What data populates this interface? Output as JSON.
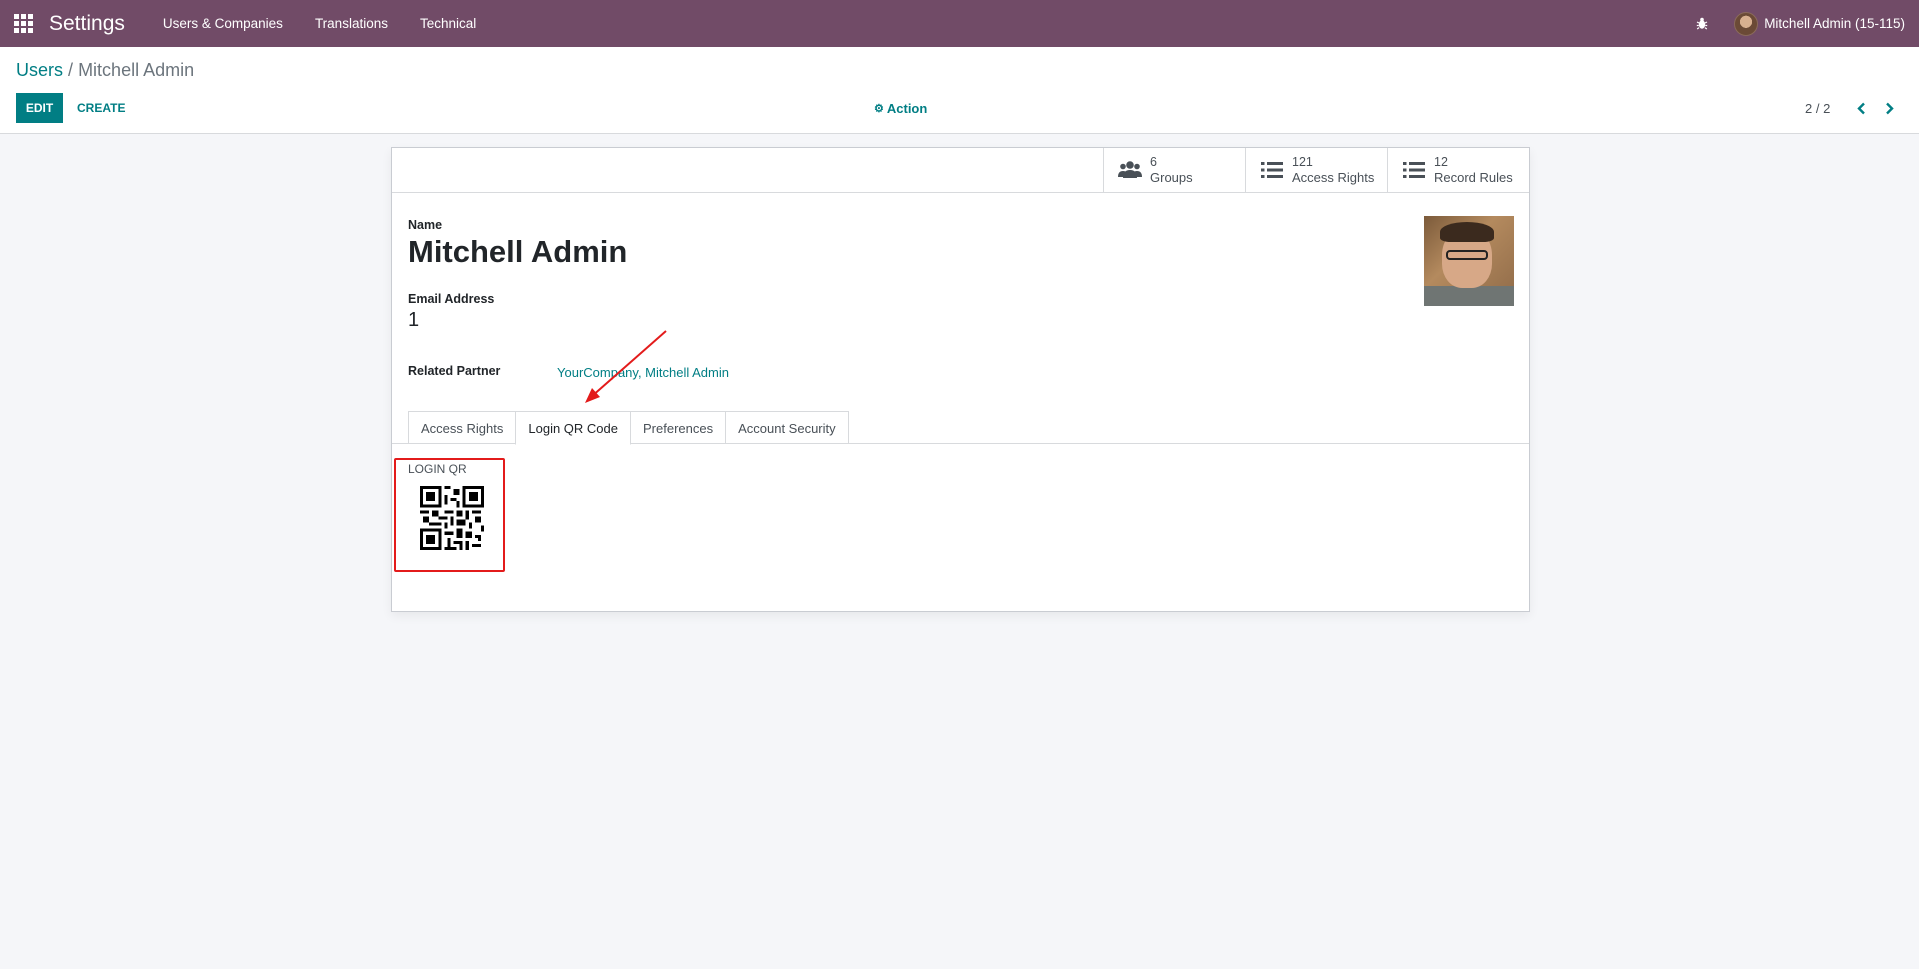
{
  "navbar": {
    "app_name": "Settings",
    "menu": [
      "Users & Companies",
      "Translations",
      "Technical"
    ],
    "user_name": "Mitchell Admin (15-115)",
    "bg_color": "#714b67",
    "icons": [
      "apps-grid-icon",
      "bug-icon"
    ]
  },
  "control_panel": {
    "breadcrumb_parent": "Users",
    "breadcrumb_separator": "/",
    "breadcrumb_current": "Mitchell Admin",
    "edit_label": "EDIT",
    "create_label": "CREATE",
    "action_label": "Action",
    "pager": "2 / 2",
    "accent_color": "#017e84"
  },
  "stat_buttons": [
    {
      "value": "6",
      "label": "Groups",
      "icon": "users-icon"
    },
    {
      "value": "121",
      "label": "Access Rights",
      "icon": "list-icon"
    },
    {
      "value": "12",
      "label": "Record Rules",
      "icon": "list-icon"
    }
  ],
  "form": {
    "name_label": "Name",
    "name_value": "Mitchell Admin",
    "email_label": "Email Address",
    "email_value": "1",
    "partner_label": "Related Partner",
    "partner_value": "YourCompany, Mitchell Admin"
  },
  "tabs": [
    {
      "label": "Access Rights",
      "active": false
    },
    {
      "label": "Login QR Code",
      "active": true
    },
    {
      "label": "Preferences",
      "active": false
    },
    {
      "label": "Account Security",
      "active": false
    }
  ],
  "qr_section": {
    "label": "LOGIN QR"
  },
  "annotation_color": "#e31b1b"
}
